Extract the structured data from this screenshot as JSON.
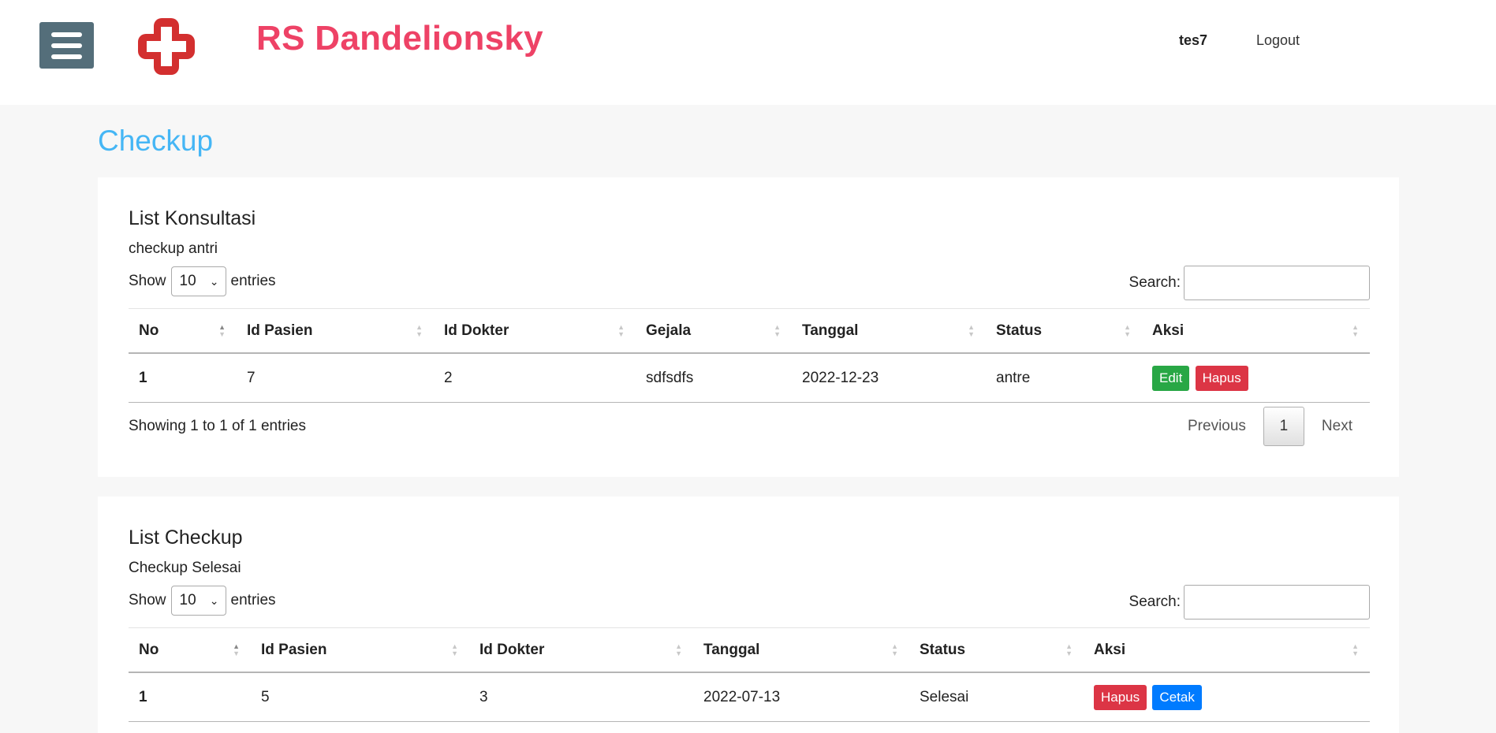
{
  "header": {
    "brand": "RS Dandelionsky",
    "username": "tes7",
    "logout_label": "Logout",
    "brand_color": "#ee4266",
    "menu_icon": "hamburger-icon",
    "logo_icon": "red-cross-icon"
  },
  "page_title": "Checkup",
  "konsultasi": {
    "title": "List Konsultasi",
    "subtitle": "checkup antri",
    "show_label": "Show",
    "entries_value": "10",
    "entries_label": "entries",
    "search_label": "Search:",
    "columns": [
      "No",
      "Id Pasien",
      "Id Dokter",
      "Gejala",
      "Tanggal",
      "Status",
      "Aksi"
    ],
    "rows": [
      {
        "no": "1",
        "id_pasien": "7",
        "id_dokter": "2",
        "gejala": "sdfsdfs",
        "tanggal": "2022-12-23",
        "status": "antre",
        "edit_label": "Edit",
        "hapus_label": "Hapus"
      }
    ],
    "info": "Showing 1 to 1 of 1 entries",
    "pagination": {
      "previous": "Previous",
      "current": "1",
      "next": "Next"
    }
  },
  "checkup": {
    "title": "List Checkup",
    "subtitle": "Checkup Selesai",
    "show_label": "Show",
    "entries_value": "10",
    "entries_label": "entries",
    "search_label": "Search:",
    "columns": [
      "No",
      "Id Pasien",
      "Id Dokter",
      "Tanggal",
      "Status",
      "Aksi"
    ],
    "rows": [
      {
        "no": "1",
        "id_pasien": "5",
        "id_dokter": "3",
        "tanggal": "2022-07-13",
        "status": "Selesai",
        "hapus_label": "Hapus",
        "cetak_label": "Cetak"
      }
    ]
  }
}
